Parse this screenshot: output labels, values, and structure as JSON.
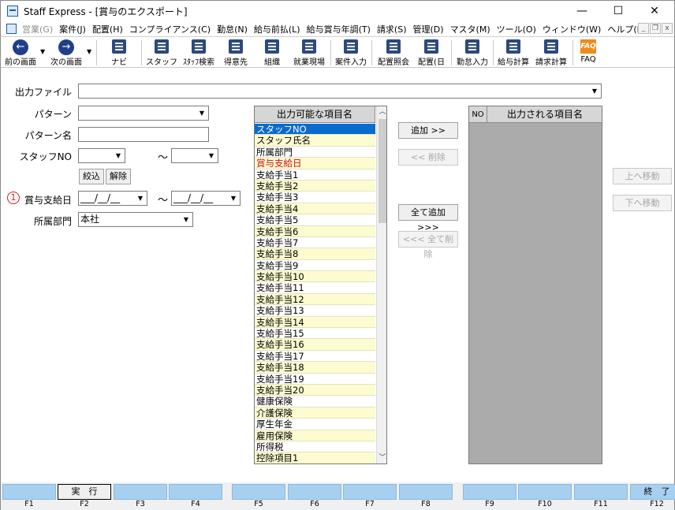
{
  "window": {
    "title": "Staff Express - [賞与のエクスポート]",
    "minimize": "—",
    "maximize": "☐",
    "close": "✕"
  },
  "menubar": {
    "items": [
      {
        "label": "営業(G)",
        "disabled": true
      },
      {
        "label": "案件(J)"
      },
      {
        "label": "配置(H)"
      },
      {
        "label": "コンプライアンス(C)"
      },
      {
        "label": "勤怠(N)"
      },
      {
        "label": "給与前払(L)"
      },
      {
        "label": "給与賞与年調(T)"
      },
      {
        "label": "請求(S)"
      },
      {
        "label": "管理(D)"
      },
      {
        "label": "マスタ(M)"
      },
      {
        "label": "ツール(O)"
      },
      {
        "label": "ウィンドウ(W)"
      },
      {
        "label": "ヘルプ(H)"
      }
    ],
    "mdi_minimize": "_",
    "mdi_restore": "❐",
    "mdi_close": "x"
  },
  "toolbar": {
    "back": {
      "label": "前の画面",
      "icon": "arrow-left-icon"
    },
    "forward": {
      "label": "次の画面",
      "icon": "arrow-right-icon"
    },
    "navi": {
      "label": "ナビ",
      "icon": "keyboard-icon"
    },
    "staff": {
      "label": "スタッフ",
      "icon": "person-icon"
    },
    "staff_search": {
      "label": "ｽﾀｯﾌ検索",
      "icon": "person-search-icon"
    },
    "client": {
      "label": "得意先",
      "icon": "building-icon"
    },
    "organization": {
      "label": "組織",
      "icon": "org-icon"
    },
    "worksite": {
      "label": "就業現場",
      "icon": "site-icon"
    },
    "case_input": {
      "label": "案件入力",
      "icon": "case-icon"
    },
    "assign_inquiry": {
      "label": "配置照会",
      "icon": "people-icon"
    },
    "assign_day": {
      "label": "配置(日",
      "icon": "people-day-icon"
    },
    "attendance_input": {
      "label": "勤怠入力",
      "icon": "attendance-icon"
    },
    "payroll_calc": {
      "label": "給与計算",
      "icon": "payroll-icon"
    },
    "billing_calc": {
      "label": "請求計算",
      "icon": "billing-icon"
    },
    "faq": {
      "label": "FAQ",
      "icon": "faq-icon",
      "icon_text": "FAQ"
    }
  },
  "form": {
    "output_file_label": "出力ファイル",
    "output_file_value": "",
    "pattern_label": "パターン",
    "pattern_value": "",
    "pattern_name_label": "パターン名",
    "pattern_name_value": "",
    "staff_no_label": "スタッフNO",
    "staff_no_from": "",
    "staff_no_to": "",
    "range_sep": "～",
    "narrow_button": "絞込",
    "clear_button": "解除",
    "marker": "1",
    "bonus_date_label": "賞与支給日",
    "bonus_date_from": "___/__/__",
    "bonus_date_to": "___/__/__",
    "department_label": "所属部門",
    "department_value": "本社"
  },
  "available_list": {
    "header": "出力可能な項目名",
    "items": [
      {
        "label": "スタッフNO",
        "selected": true
      },
      {
        "label": "スタッフ氏名"
      },
      {
        "label": "所属部門"
      },
      {
        "label": "賞与支給日",
        "red": true
      },
      {
        "label": "支給手当1"
      },
      {
        "label": "支給手当2"
      },
      {
        "label": "支給手当3"
      },
      {
        "label": "支給手当4"
      },
      {
        "label": "支給手当5"
      },
      {
        "label": "支給手当6"
      },
      {
        "label": "支給手当7"
      },
      {
        "label": "支給手当8"
      },
      {
        "label": "支給手当9"
      },
      {
        "label": "支給手当10"
      },
      {
        "label": "支給手当11"
      },
      {
        "label": "支給手当12"
      },
      {
        "label": "支給手当13"
      },
      {
        "label": "支給手当14"
      },
      {
        "label": "支給手当15"
      },
      {
        "label": "支給手当16"
      },
      {
        "label": "支給手当17"
      },
      {
        "label": "支給手当18"
      },
      {
        "label": "支給手当19"
      },
      {
        "label": "支給手当20"
      },
      {
        "label": "健康保険"
      },
      {
        "label": "介護保険"
      },
      {
        "label": "厚生年金"
      },
      {
        "label": "雇用保険"
      },
      {
        "label": "所得税"
      },
      {
        "label": "控除項目1"
      }
    ]
  },
  "transfer": {
    "add": "追加 >>",
    "remove": "<< 削除",
    "add_all": "全て追加 >>>",
    "remove_all": "<<< 全て削除"
  },
  "output_list": {
    "no_header": "NO",
    "name_header": "出力される項目名"
  },
  "order": {
    "move_up": "上へ移動",
    "move_down": "下へ移動"
  },
  "fkeys": [
    {
      "key": "F1",
      "label": ""
    },
    {
      "key": "F2",
      "label": "実　行"
    },
    {
      "key": "F3",
      "label": ""
    },
    {
      "key": "F4",
      "label": ""
    },
    {
      "key": "F5",
      "label": ""
    },
    {
      "key": "F6",
      "label": ""
    },
    {
      "key": "F7",
      "label": ""
    },
    {
      "key": "F8",
      "label": ""
    },
    {
      "key": "F9",
      "label": ""
    },
    {
      "key": "F10",
      "label": ""
    },
    {
      "key": "F11",
      "label": ""
    },
    {
      "key": "F12",
      "label": "終　了"
    }
  ]
}
